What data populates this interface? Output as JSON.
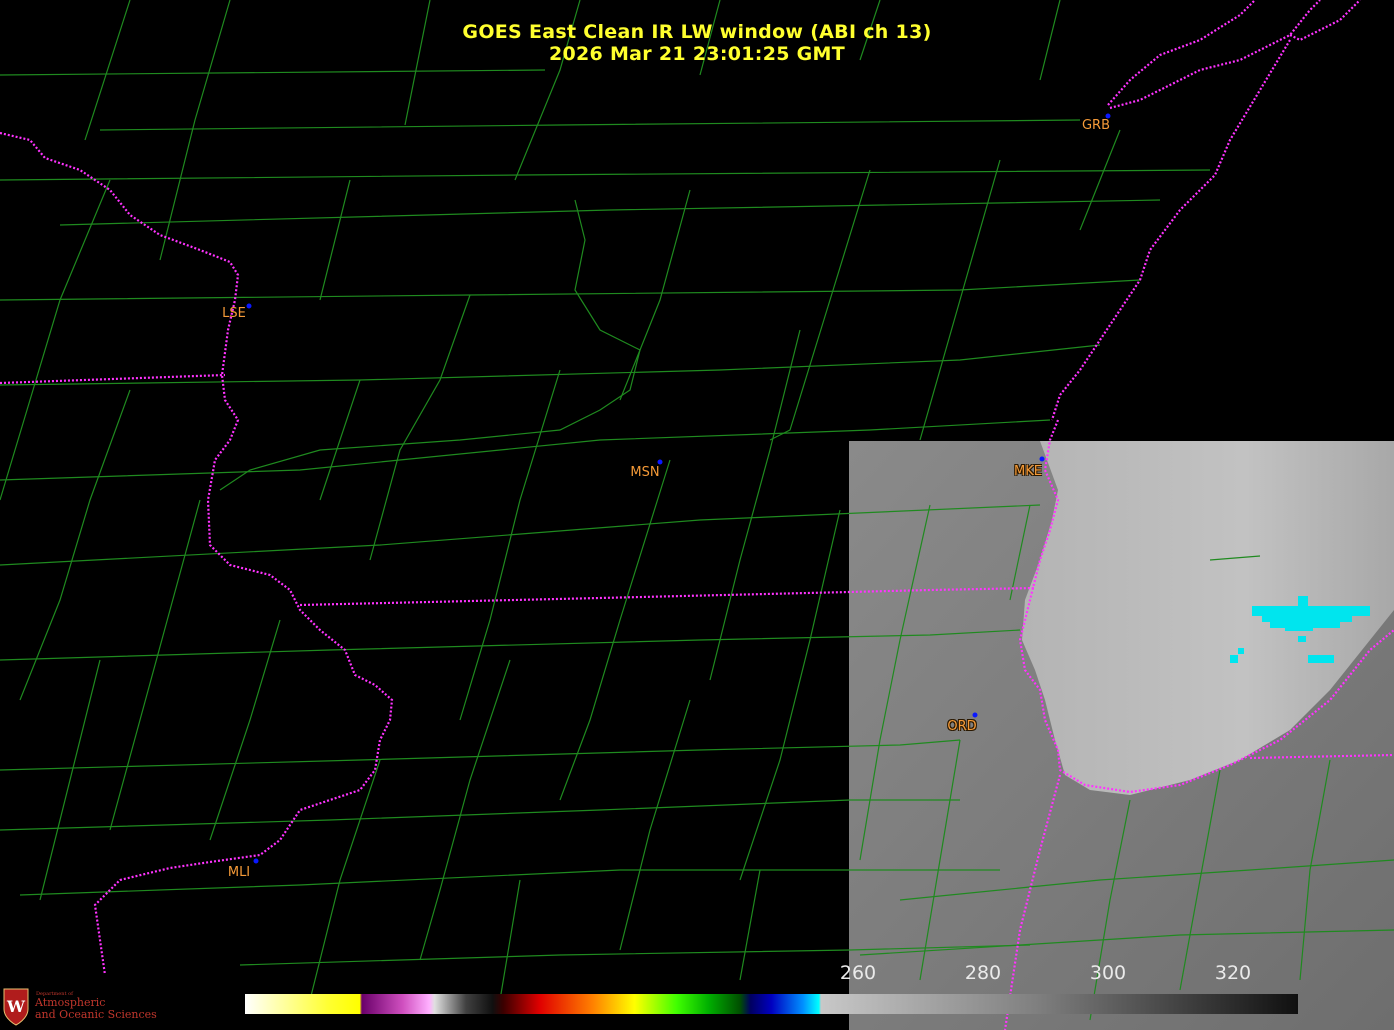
{
  "title": {
    "line1": "GOES East Clean IR LW window (ABI ch 13)",
    "line2": "2026 Mar 21  23:01:25 GMT"
  },
  "stations": [
    {
      "id": "LSE",
      "label": "LSE"
    },
    {
      "id": "MSN",
      "label": "MSN"
    },
    {
      "id": "GRB",
      "label": "GRB"
    },
    {
      "id": "MKE",
      "label": "MKE"
    },
    {
      "id": "ORD",
      "label": "ORD"
    },
    {
      "id": "MLI",
      "label": "MLI"
    }
  ],
  "colorbar": {
    "ticks": [
      "260",
      "280",
      "300",
      "320"
    ],
    "units_note": ""
  },
  "logo": {
    "line_small": "Department of",
    "line1": "Atmospheric",
    "line2": "and Oceanic Sciences"
  },
  "colors": {
    "title": "#ffff2e",
    "county_lines": "#1f8a1f",
    "state_lines": "#ff33ff",
    "station_label": "#f59a38",
    "station_dot": "#0a18ff",
    "cloud_highlight": "#00e5ee"
  }
}
